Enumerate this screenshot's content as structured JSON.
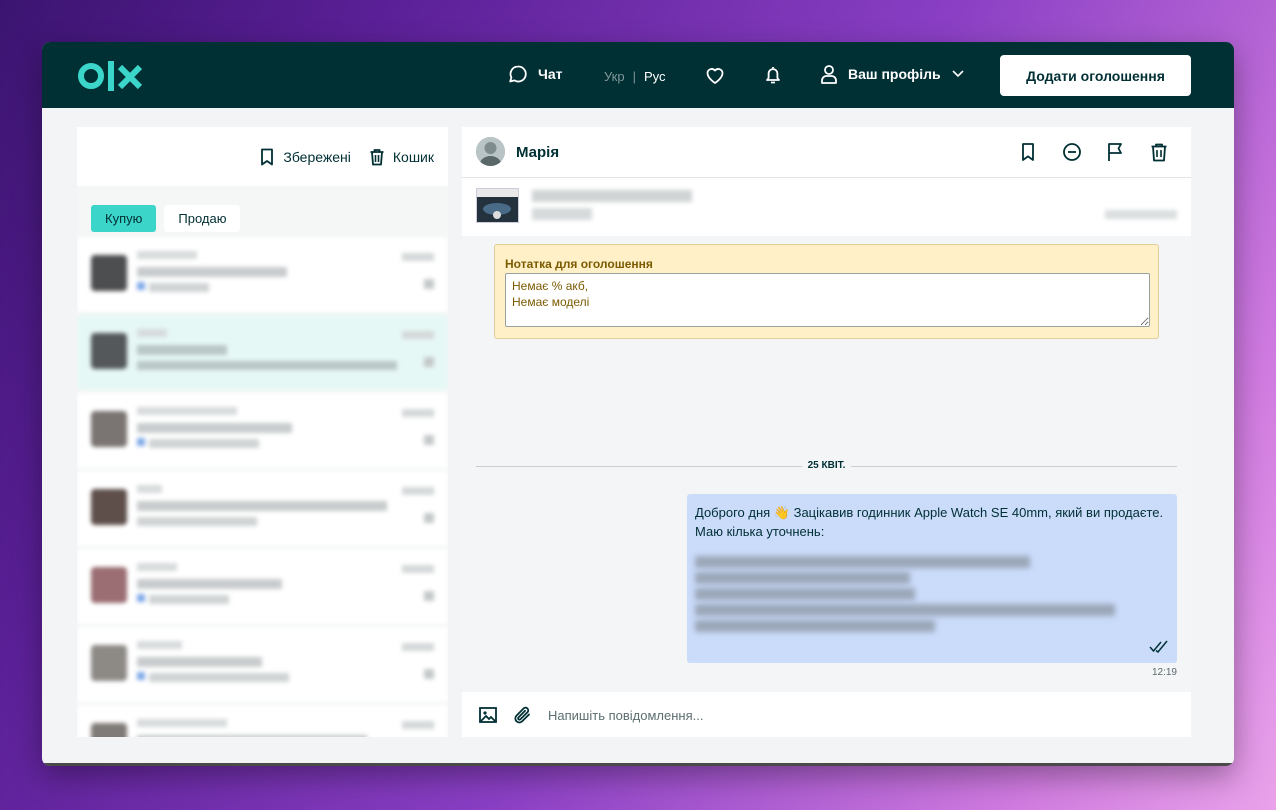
{
  "colors": {
    "topbar": "#002f34",
    "accent": "#3bd5c9",
    "note_bg": "#fff0c7",
    "bubble_bg": "#cbdcfb"
  },
  "topbar": {
    "logo_icon": "olx-logo",
    "chat_label": "Чат",
    "lang_ukr": "Укр",
    "lang_sep": "|",
    "lang_rus": "Рус",
    "profile_label": "Ваш профіль",
    "add_button": "Додати оголошення"
  },
  "sidebar": {
    "saved_label": "Збережені",
    "trash_label": "Кошик",
    "tabs": [
      {
        "label": "Купую",
        "active": true
      },
      {
        "label": "Продаю",
        "active": false
      }
    ]
  },
  "chat": {
    "contact_name": "Марія",
    "note_title": "Нотатка для оголошення",
    "note_text": "Немає % акб,\nНемає моделі",
    "date_separator": "25 КВІТ.",
    "message_text": "Доброго дня 👋 Зацікавив годинник Apple Watch SE 40mm, який ви продаєте. Маю кілька уточнень:",
    "message_time": "12:19",
    "composer_placeholder": "Напишіть повідомлення..."
  }
}
